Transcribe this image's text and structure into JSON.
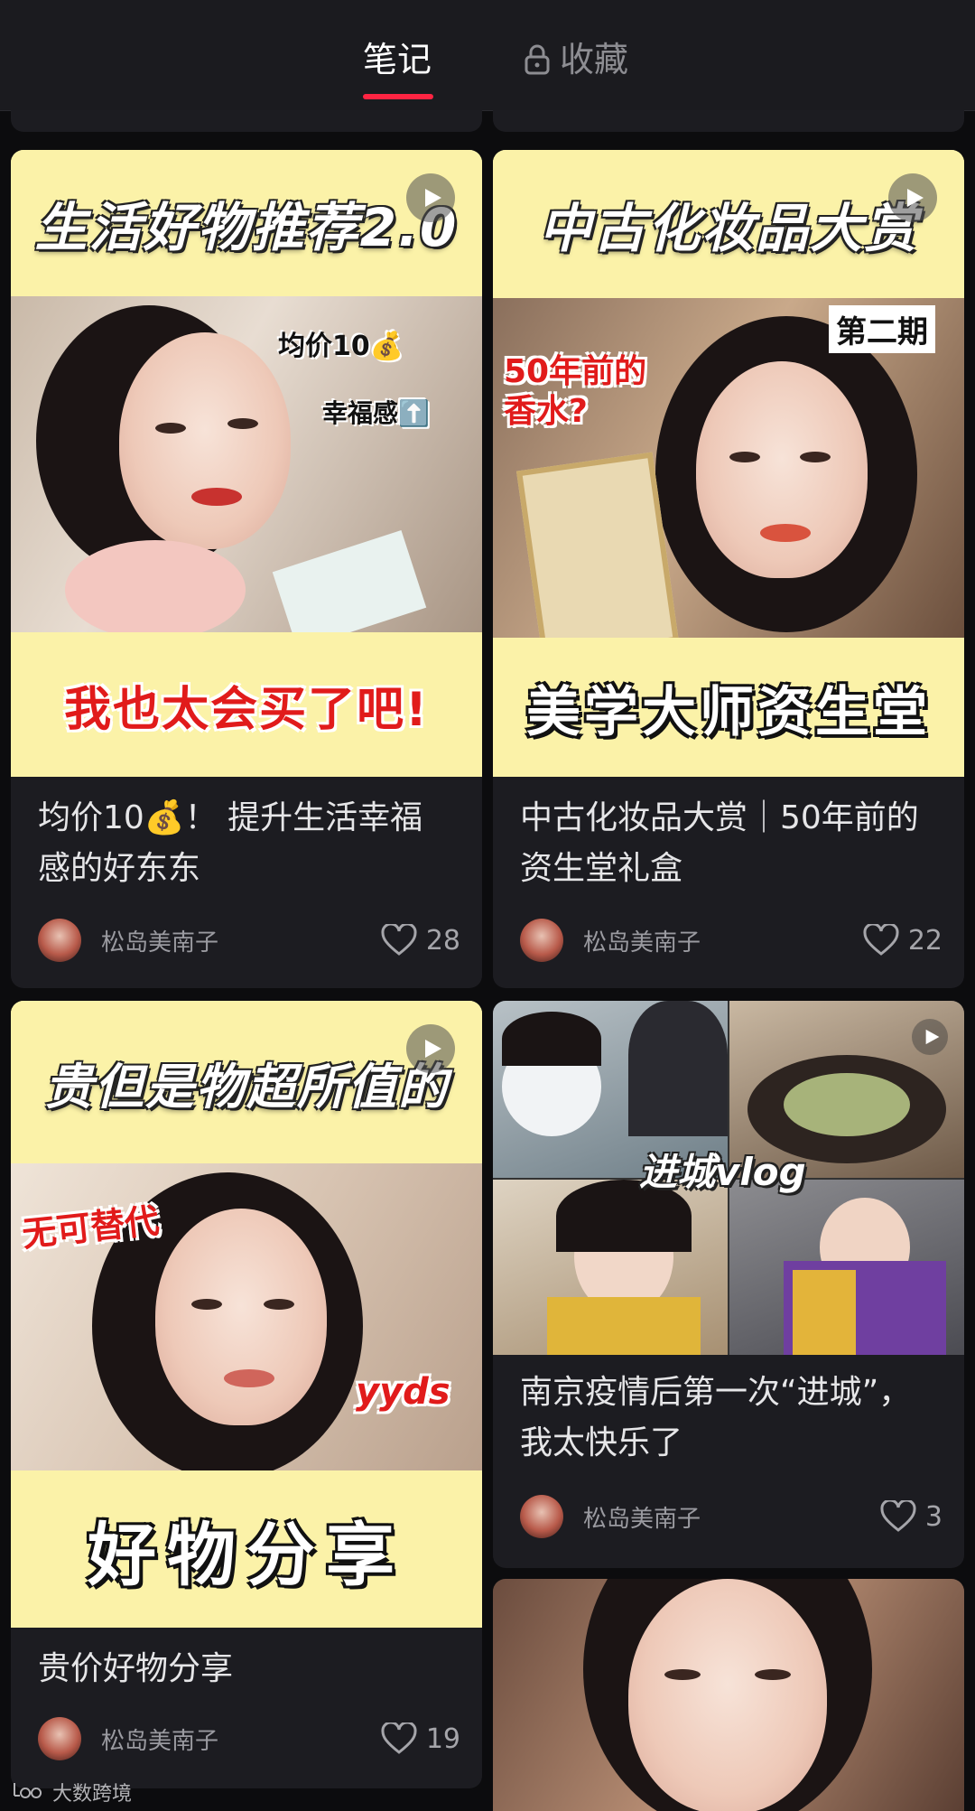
{
  "tabs": [
    {
      "label": "笔记",
      "active": true
    },
    {
      "label": "收藏",
      "active": false,
      "icon": "lock-icon"
    }
  ],
  "accent_color": "#ff2442",
  "posts": [
    {
      "cover_top": "生活好物推荐2.0",
      "cover_bottom": "我也太会买了吧!",
      "stickers": [
        "均价10💰",
        "幸福感⬆️"
      ],
      "title": "均价10💰！ 提升生活幸福感的好东东",
      "author": "松岛美南子",
      "likes": "28",
      "is_video": true
    },
    {
      "cover_top": "中古化妆品大赏",
      "cover_bottom": "美学大师资生堂",
      "stickers": [
        "第二期",
        "50年前的 香水?"
      ],
      "title": "中古化妆品大赏｜50年前的资生堂礼盒",
      "author": "松岛美南子",
      "likes": "22",
      "is_video": true
    },
    {
      "cover_top": "贵但是物超所值的",
      "cover_bottom": "好物分享",
      "stickers": [
        "无可替代",
        "yyds"
      ],
      "title": "贵价好物分享",
      "author": "松岛美南子",
      "likes": "19",
      "is_video": true
    },
    {
      "cover_top": "",
      "cover_bottom": "",
      "stickers": [
        "进城vlog"
      ],
      "title": "南京疫情后第一次“进城”，我太快乐了",
      "author": "松岛美南子",
      "likes": "3",
      "is_video": true
    }
  ],
  "watermark": "大数跨境"
}
